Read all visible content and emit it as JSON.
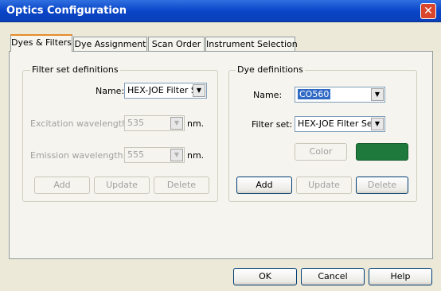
{
  "window": {
    "title": "Optics Configuration",
    "close_label": "✕"
  },
  "tabs": [
    {
      "label": "Dyes & Filters",
      "active": true
    },
    {
      "label": "Dye Assignment"
    },
    {
      "label": "Scan Order"
    },
    {
      "label": "Instrument Selection"
    }
  ],
  "filter_set": {
    "group_label": "Filter set definitions",
    "name_label": "Name:",
    "name_value": "HEX-JOE Filter S",
    "excitation_label": "Excitation wavelength:",
    "excitation_value": "535",
    "excitation_unit": "nm.",
    "emission_label": "Emission wavelength:",
    "emission_value": "555",
    "emission_unit": "nm.",
    "add_label": "Add",
    "update_label": "Update",
    "delete_label": "Delete"
  },
  "dye": {
    "group_label": "Dye definitions",
    "name_label": "Name:",
    "name_value": "CO560",
    "filter_set_label": "Filter set:",
    "filter_set_value": "HEX-JOE Filter Se",
    "color_label": "Color",
    "color_swatch": "#1d7a3c",
    "add_label": "Add",
    "update_label": "Update",
    "delete_label": "Delete"
  },
  "footer": {
    "ok_label": "OK",
    "cancel_label": "Cancel",
    "help_label": "Help"
  }
}
